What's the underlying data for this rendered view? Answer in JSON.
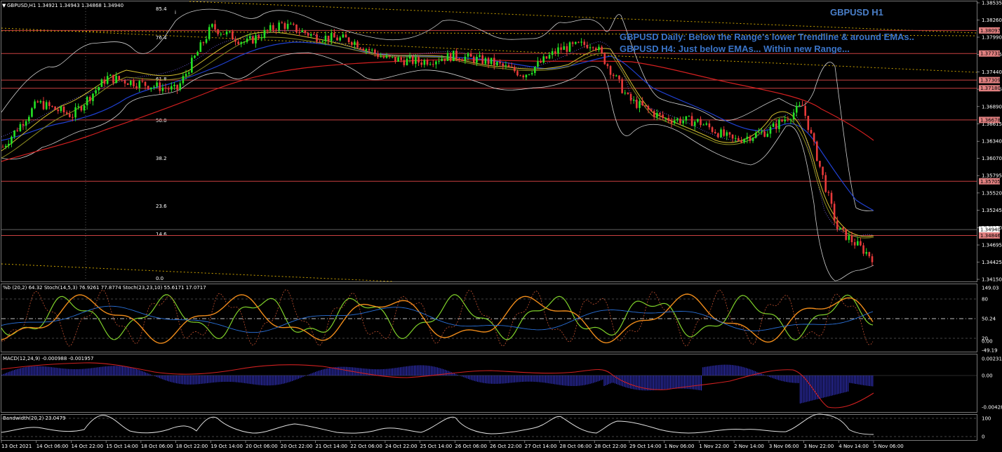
{
  "header": {
    "symbol_label": "GBPUSD,H1  1.34921 1.34943 1.34868 1.34940",
    "info_icon": "i"
  },
  "annotations": {
    "title": "GBPUSD H1",
    "line1": "GBPUSD Daily: Below the Range's lower Trendline & around EMAs..",
    "line2": "GBPUSD H4: Just below EMAs... Within new Range..."
  },
  "fib_levels": [
    "85.4",
    "76.4",
    "61.8",
    "50.0",
    "38.2",
    "23.6",
    "14.6",
    "0.0"
  ],
  "price_axis": {
    "ticks": [
      "1.38535",
      "1.38260",
      "1.37990",
      "1.37715",
      "1.37440",
      "1.37165",
      "1.36890",
      "1.36615",
      "1.36340",
      "1.36070",
      "1.35795",
      "1.35520",
      "1.35245",
      "1.34970",
      "1.34695",
      "1.34425",
      "1.34150"
    ],
    "tags": [
      {
        "label": "1.38097",
        "color": "#e08080"
      },
      {
        "label": "1.37731",
        "color": "#e08080"
      },
      {
        "label": "1.37309",
        "color": "#e08080"
      },
      {
        "label": "1.37180",
        "color": "#e08080"
      },
      {
        "label": "1.36678",
        "color": "#e08080"
      },
      {
        "label": "1.35705",
        "color": "#e08080"
      },
      {
        "label": "1.34940",
        "color": "#ffffff"
      },
      {
        "label": "1.34846",
        "color": "#e08080"
      }
    ]
  },
  "time_axis": [
    "13 Oct 2021",
    "14 Oct 06:00",
    "14 Oct 22:00",
    "15 Oct 14:00",
    "18 Oct 06:00",
    "18 Oct 22:00",
    "19 Oct 14:00",
    "20 Oct 06:00",
    "20 Oct 22:00",
    "21 Oct 14:00",
    "22 Oct 06:00",
    "24 Oct 22:00",
    "25 Oct 14:00",
    "26 Oct 06:00",
    "26 Oct 22:00",
    "27 Oct 14:00",
    "28 Oct 06:00",
    "28 Oct 22:00",
    "29 Oct 14:00",
    "1 Nov 06:00",
    "1 Nov 22:00",
    "2 Nov 14:00",
    "3 Nov 06:00",
    "3 Nov 22:00",
    "4 Nov 14:00",
    "5 Nov 06:00"
  ],
  "stoch_panel": {
    "label": "%b (20,2) 64.32  Stoch(14,5,3) 76.9261 77.8774  Stoch(23,23,10) 55.6171 17.0717",
    "ticks": [
      "149.03",
      "80",
      "50.24",
      "20",
      "0.00",
      "-49.19"
    ]
  },
  "macd_panel": {
    "label": "MACD(12,24,9) -0.000988 -0.001957",
    "ticks": [
      "0.002316",
      "0.00",
      "-0.004287"
    ]
  },
  "bw_panel": {
    "label": "Bandwidth(20,2) 23.0479",
    "ticks": [
      "100",
      "0"
    ]
  },
  "chart_data": {
    "type": "line",
    "symbol": "GBPUSD",
    "timeframe": "H1",
    "last_close": 1.3494,
    "ylim": [
      1.3415,
      1.38535
    ],
    "x": [
      "13 Oct 2021",
      "14 Oct 06:00",
      "14 Oct 22:00",
      "15 Oct 14:00",
      "18 Oct 06:00",
      "18 Oct 22:00",
      "19 Oct 14:00",
      "20 Oct 06:00",
      "20 Oct 22:00",
      "21 Oct 14:00",
      "22 Oct 06:00",
      "24 Oct 22:00",
      "25 Oct 14:00",
      "26 Oct 06:00",
      "26 Oct 22:00",
      "27 Oct 14:00",
      "28 Oct 06:00",
      "28 Oct 22:00",
      "29 Oct 14:00",
      "1 Nov 06:00",
      "1 Nov 22:00",
      "2 Nov 14:00",
      "3 Nov 06:00",
      "3 Nov 22:00",
      "4 Nov 14:00",
      "5 Nov 06:00"
    ],
    "series": [
      {
        "name": "GBPUSD,H1",
        "values": [
          1.3625,
          1.3695,
          1.3675,
          1.3735,
          1.3725,
          1.3715,
          1.3815,
          1.379,
          1.382,
          1.38,
          1.3795,
          1.3765,
          1.376,
          1.377,
          1.376,
          1.374,
          1.378,
          1.379,
          1.37,
          1.367,
          1.3665,
          1.3635,
          1.365,
          1.369,
          1.3495,
          1.345
        ]
      }
    ],
    "horizontal_levels": [
      1.38097,
      1.37731,
      1.37309,
      1.3718,
      1.36678,
      1.35705,
      1.34846
    ]
  }
}
